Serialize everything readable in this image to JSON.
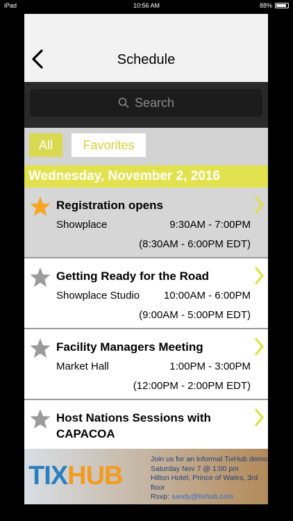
{
  "status": {
    "device": "iPad",
    "time": "10:56 AM",
    "battery": "88%"
  },
  "nav": {
    "title": "Schedule",
    "back_icon": "chevron-left-icon"
  },
  "search": {
    "placeholder": "Search",
    "icon": "search-icon"
  },
  "filters": {
    "all_label": "All",
    "favorites_label": "Favorites"
  },
  "day_header": "Wednesday, November 2, 2016",
  "events": [
    {
      "name": "Registration opens",
      "location": "Showplace",
      "time": "9:30AM - 7:00PM",
      "time_edt": "(8:30AM - 6:00PM EDT)",
      "favorite": true,
      "selected": true
    },
    {
      "name": "Getting Ready for the Road",
      "location": "Showplace Studio",
      "time": "10:00AM - 6:00PM",
      "time_edt": "(9:00AM - 5:00PM EDT)",
      "favorite": false,
      "selected": false
    },
    {
      "name": "Facility Managers Meeting",
      "location": "Market Hall",
      "time": "1:00PM - 3:00PM",
      "time_edt": "(12:00PM - 2:00PM EDT)",
      "favorite": false,
      "selected": false
    },
    {
      "name": "Host Nations Sessions with CAPACOA",
      "location": "",
      "time": "",
      "time_edt": "",
      "favorite": false,
      "selected": false
    }
  ],
  "ad": {
    "logo_part1": "TIX",
    "logo_part2": "HUB",
    "line1": "Join us for an informal TixHub demo",
    "line2": "Saturday Nov 7 @ 1:00 pm",
    "line3": "Hilton Hotel, Prince of Wales, 3rd floor",
    "rsvp_label": "Rsvp:",
    "rsvp_email": "sandy@tixhub.com"
  },
  "colors": {
    "accent_yellow": "#e2e24e",
    "star_favorite": "#f5a623",
    "star_default": "#9b9b9b",
    "chevron": "#e0e040"
  }
}
